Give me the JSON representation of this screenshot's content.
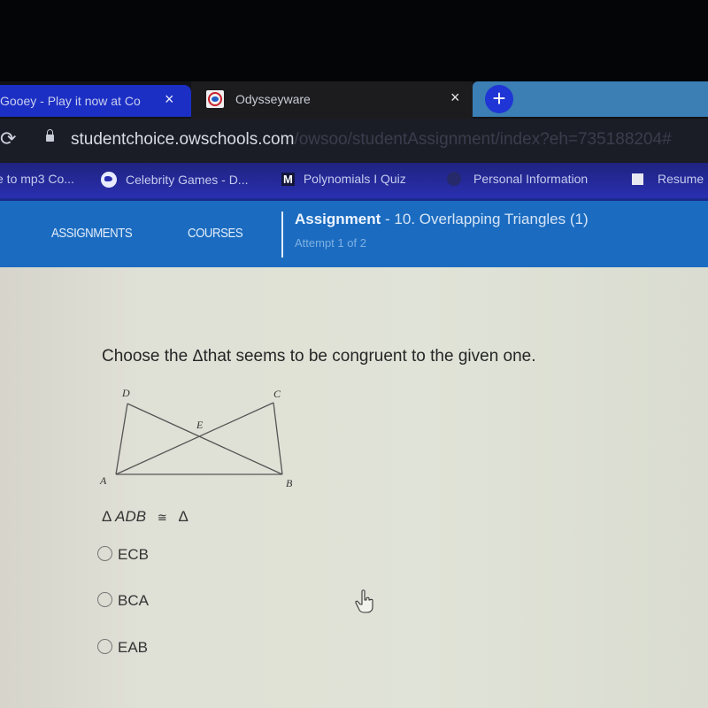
{
  "browser": {
    "tabs": [
      {
        "title": "Gooey - Play it now at Co",
        "active": false,
        "close_icon": "×"
      },
      {
        "title": "Odysseyware",
        "active": true,
        "close_icon": "×",
        "favicon": "odysseyware-logo"
      }
    ],
    "new_tab_label": "+",
    "address": {
      "reload_icon": "⟳",
      "domain": "studentchoice.owschools.com",
      "path": "/owsoo/studentAssignment/index?eh=735188204#"
    },
    "bookmarks": [
      {
        "label": "e to mp3 Co...",
        "icon": "none"
      },
      {
        "label": "Celebrity Games - D...",
        "icon": "globe-icon"
      },
      {
        "label": "Polynomials I Quiz",
        "icon": "m-icon",
        "icon_text": "M"
      },
      {
        "label": "Personal Information",
        "icon": "dot-icon"
      },
      {
        "label": "Resume",
        "icon": "document-icon"
      }
    ]
  },
  "appnav": {
    "links": [
      "ASSIGNMENTS",
      "COURSES"
    ],
    "assignment_label": "Assignment",
    "assignment_name": " - 10. Overlapping Triangles (1)",
    "attempt": "Attempt 1 of 2",
    "colors": {
      "nav_bg": "#1b6cc0",
      "tab_active": "#1c1c1e",
      "tab_inactive": "#1c2fc4"
    }
  },
  "question": {
    "prefix": "Choose the ",
    "triangle_symbol": "Δ",
    "suffix": "that seems to be congruent to the given one.",
    "diagram_labels": {
      "A": "A",
      "B": "B",
      "C": "C",
      "D": "D",
      "E": "E"
    },
    "statement": {
      "triangle_symbol": "Δ",
      "given": "ADB",
      "congruent_symbol": "≅",
      "answer_symbol": "Δ"
    },
    "options": [
      "ECB",
      "BCA",
      "EAB"
    ],
    "selected": null
  }
}
